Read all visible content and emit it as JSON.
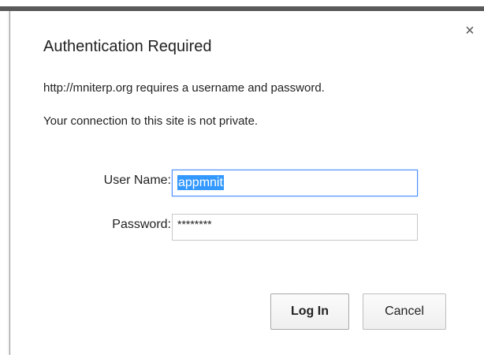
{
  "dialog": {
    "title": "Authentication Required",
    "message_line1": "http://mniterp.org requires a username and password.",
    "message_line2": "Your connection to this site is not private.",
    "close_glyph": "×"
  },
  "form": {
    "username_label": "User Name:",
    "username_value": "appmnit",
    "password_label": "Password:",
    "password_value": "********"
  },
  "buttons": {
    "login_label": "Log In",
    "cancel_label": "Cancel"
  },
  "colors": {
    "selection": "#3399ff",
    "focus_border": "#4d90fe"
  }
}
